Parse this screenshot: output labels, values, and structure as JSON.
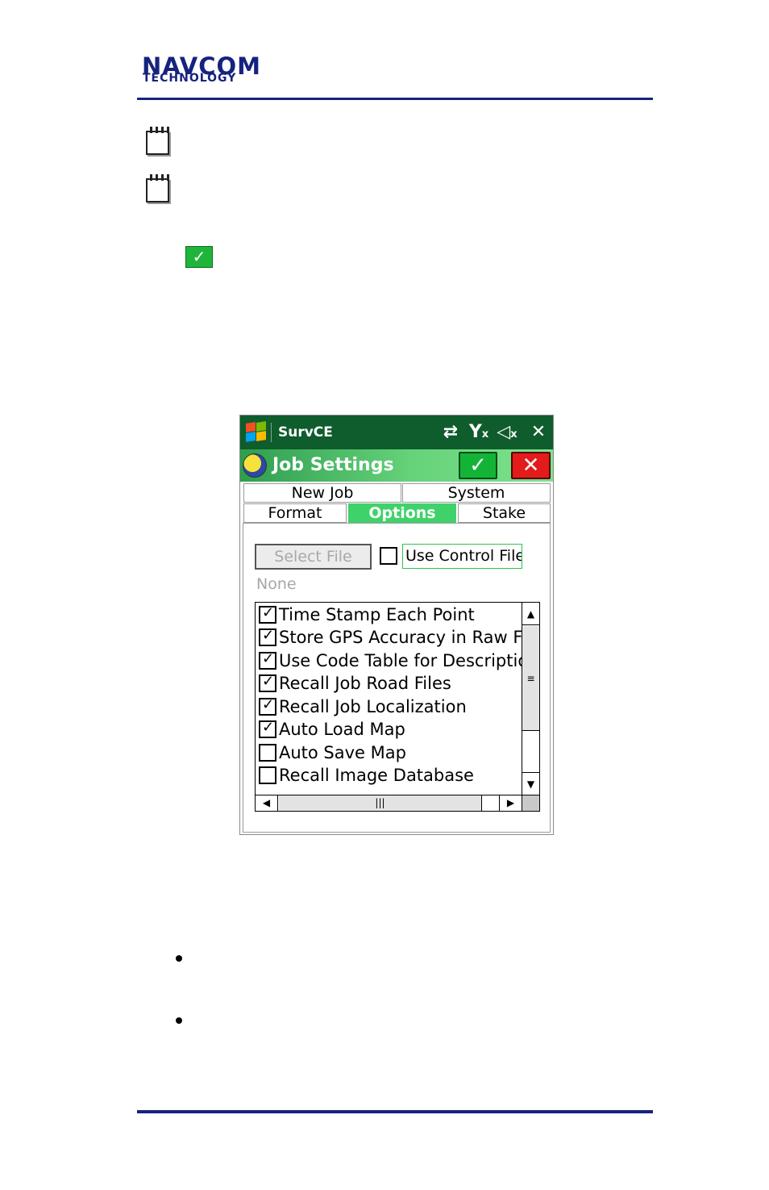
{
  "page": {
    "logo_line1": "NAVCOM",
    "logo_line2": "TECHNOLOGY"
  },
  "device": {
    "app_title": "SurvCE",
    "status_icons": [
      "sync-arrows-icon",
      "no-signal-icon",
      "speaker-muted-icon",
      "close-icon"
    ],
    "header_title": "Job Settings",
    "tabs_row1": [
      "New Job",
      "System"
    ],
    "tabs_row2": [
      "Format",
      "Options",
      "Stake"
    ],
    "active_tab": "Options",
    "select_file_label": "Select File",
    "use_control_file_label": "Use Control File",
    "use_control_file_checked": false,
    "file_value": "None",
    "options_list": [
      {
        "label": "Time Stamp Each Point",
        "checked": true
      },
      {
        "label": "Store GPS Accuracy in Raw File",
        "checked": true
      },
      {
        "label": "Use Code Table for Description",
        "checked": true
      },
      {
        "label": "Recall Job Road Files",
        "checked": true
      },
      {
        "label": "Recall Job Localization",
        "checked": true
      },
      {
        "label": "Auto Load Map",
        "checked": true
      },
      {
        "label": "Auto Save Map",
        "checked": false
      },
      {
        "label": "Recall Image Database",
        "checked": false
      }
    ],
    "colors": {
      "titlebar": "#0f5c2d",
      "active_tab": "#3fd26a",
      "ok_button": "#13b338",
      "cancel_button": "#e31b1b"
    }
  }
}
